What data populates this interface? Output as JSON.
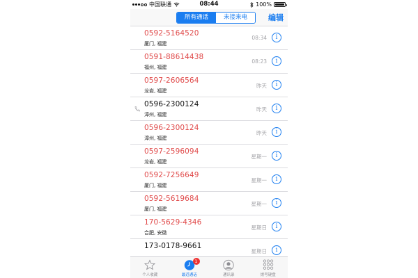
{
  "status_bar": {
    "carrier": "中国联通",
    "time": "08:44",
    "battery": "100%"
  },
  "nav": {
    "segments": [
      {
        "label": "所有通话",
        "active": true
      },
      {
        "label": "未接来电",
        "active": false
      }
    ],
    "edit_label": "编辑"
  },
  "calls": [
    {
      "number": "0592-5164520",
      "location": "厦门, 福建",
      "time": "08:34",
      "missed": true
    },
    {
      "number": "0591-88614438",
      "location": "福州, 福建",
      "time": "08:23",
      "missed": true
    },
    {
      "number": "0597-2606564",
      "location": "龙岩, 福建",
      "time": "昨天",
      "missed": true
    },
    {
      "number": "0596-2300124",
      "location": "漳州, 福建",
      "time": "昨天",
      "missed": false,
      "outgoing": true
    },
    {
      "number": "0596-2300124",
      "location": "漳州, 福建",
      "time": "昨天",
      "missed": true
    },
    {
      "number": "0597-2596094",
      "location": "龙岩, 福建",
      "time": "星期一",
      "missed": true
    },
    {
      "number": "0592-7256649",
      "location": "厦门, 福建",
      "time": "星期一",
      "missed": true
    },
    {
      "number": "0592-5619684",
      "location": "厦门, 福建",
      "time": "星期一",
      "missed": true
    },
    {
      "number": "170-5629-4346",
      "location": "合肥, 安徽",
      "time": "星期日",
      "missed": true
    },
    {
      "number": "173-0178-9661",
      "location": "",
      "time": "星期日",
      "missed": false
    }
  ],
  "tabs": [
    {
      "label": "个人收藏",
      "icon": "star-icon",
      "active": false
    },
    {
      "label": "最近通话",
      "icon": "clock-icon",
      "active": true,
      "badge": "1"
    },
    {
      "label": "通讯录",
      "icon": "contacts-icon",
      "active": false
    },
    {
      "label": "拨号键盘",
      "icon": "keypad-icon",
      "active": false
    }
  ],
  "colors": {
    "accent": "#1a7df0",
    "missed": "#e04a4a",
    "secondary_text": "#a6a6aa",
    "badge": "#e33333"
  }
}
